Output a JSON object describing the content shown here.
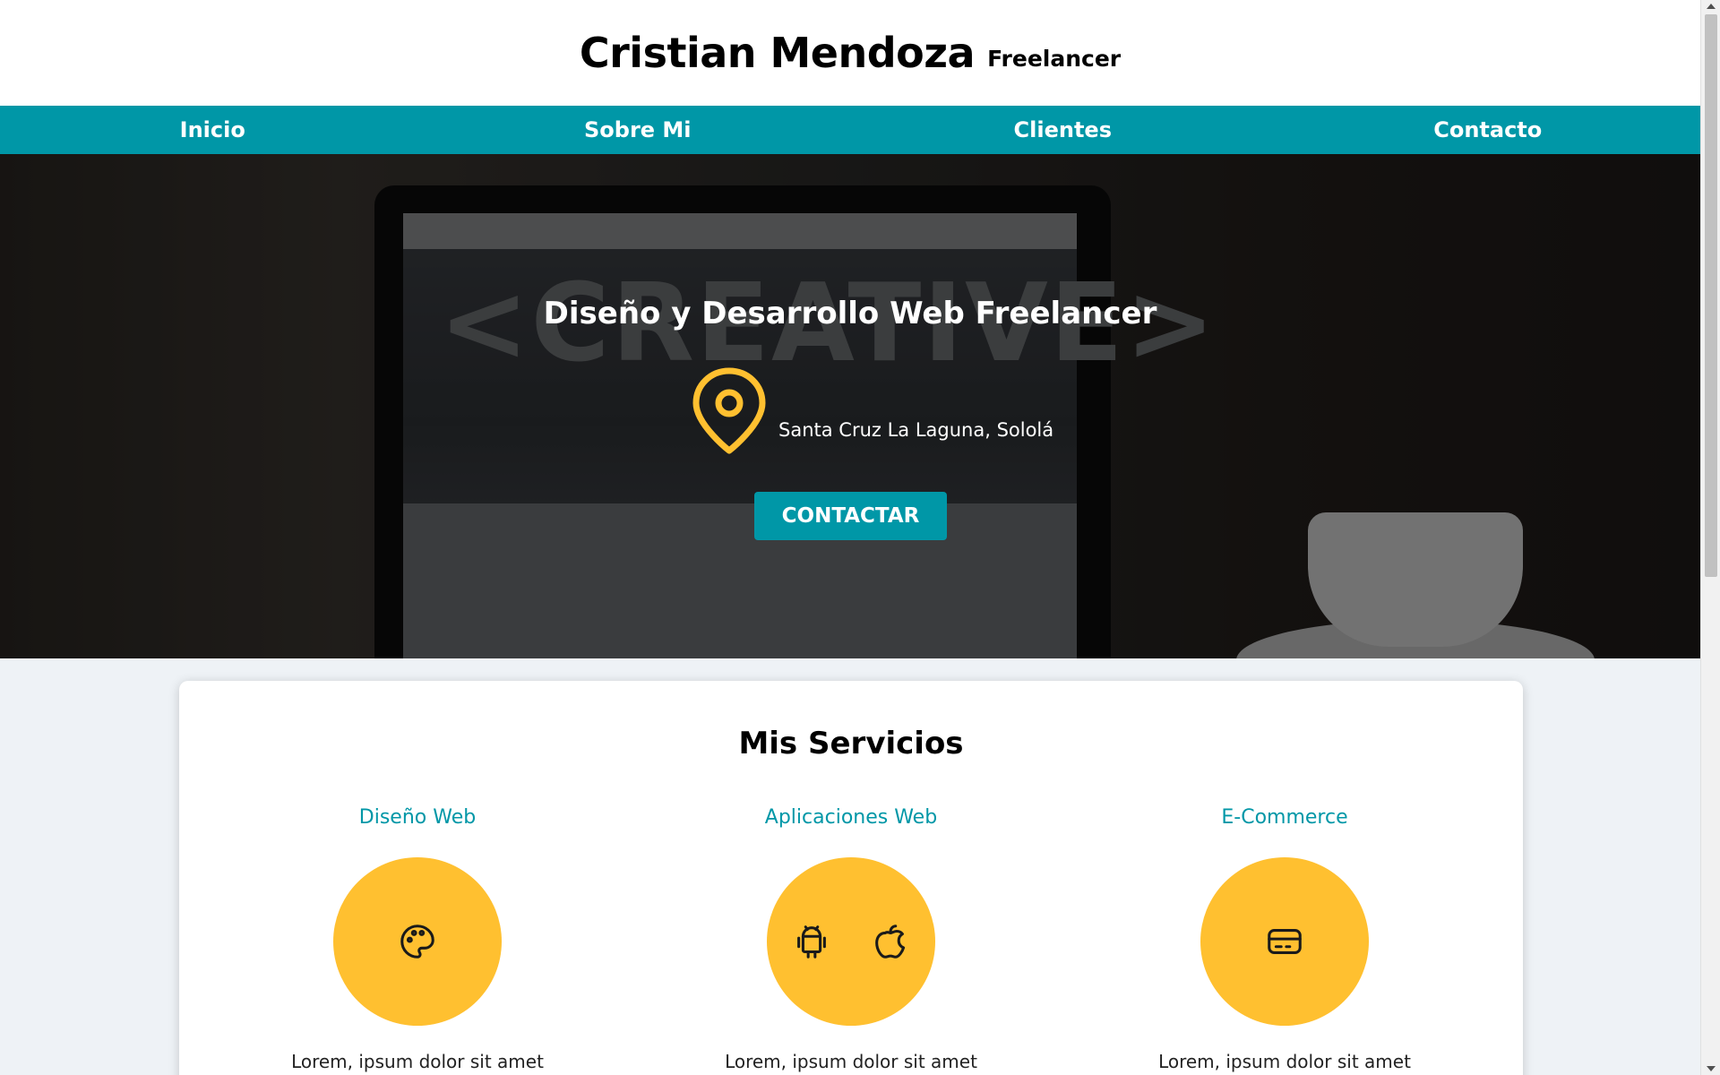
{
  "header": {
    "title": "Cristian Mendoza",
    "subtitle": "Freelancer"
  },
  "nav": {
    "items": [
      {
        "label": "Inicio"
      },
      {
        "label": "Sobre Mi"
      },
      {
        "label": "Clientes"
      },
      {
        "label": "Contacto"
      }
    ]
  },
  "hero": {
    "title": "Diseño y Desarrollo Web Freelancer",
    "location": "Santa Cruz La Laguna, Sololá",
    "location_icon": "map-pin-icon",
    "cta_label": "CONTACTAR",
    "background_text": "<CREATIVE>"
  },
  "services": {
    "title": "Mis Servicios",
    "items": [
      {
        "name": "Diseño Web",
        "icons": [
          "palette-icon"
        ],
        "description": "Lorem, ipsum dolor sit amet consectetur"
      },
      {
        "name": "Aplicaciones Web",
        "icons": [
          "android-icon",
          "apple-icon"
        ],
        "description": "Lorem, ipsum dolor sit amet consectetur"
      },
      {
        "name": "E-Commerce",
        "icons": [
          "credit-card-icon"
        ],
        "description": "Lorem, ipsum dolor sit amet consectetur"
      }
    ]
  },
  "colors": {
    "primary": "#0097a7",
    "accent": "#ffc030",
    "header_bg": "#ffffff",
    "page_bg": "#eef2f6"
  }
}
